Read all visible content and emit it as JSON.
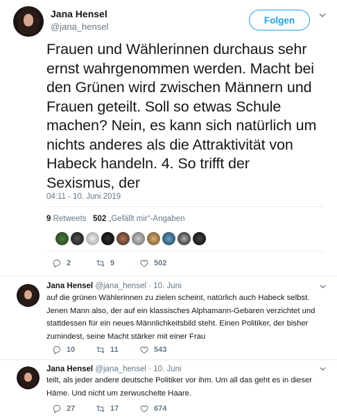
{
  "main_tweet": {
    "author_name": "Jana Hensel",
    "author_handle": "@jana_hensel",
    "follow_label": "Folgen",
    "text": "Frauen und Wählerinnen durchaus sehr ernst wahrgenommen werden. Macht bei den Grünen wird zwischen Männern und Frauen geteilt. Soll so etwas Schule machen? Nein, es kann sich natürlich um nichts anderes als die Attraktivität von Habeck handeln. 4. So trifft der Sexismus, der",
    "timestamp": "04:11 - 10. Juni 2019",
    "retweets_count": "9",
    "retweets_label": "Retweets",
    "likes_count": "502",
    "likes_label": "„Gefällt mir“-Angaben",
    "actions": {
      "replies": "2",
      "retweets": "9",
      "likes": "502"
    }
  },
  "replies": [
    {
      "author_name": "Jana Hensel",
      "author_handle": "@jana_hensel",
      "date": "· 10. Juni",
      "text": "auf die grünen Wählerinnen zu zielen scheint, natürlich auch Habeck selbst. Jenen Mann also, der auf ein klassisches  Alphamann-Gebaren verzichtet und stattdessen für ein neues Männlichkeitsbild steht. Einen Politiker, der bisher zumindest, seine Macht stärker mit einer Frau",
      "actions": {
        "replies": "10",
        "retweets": "11",
        "likes": "543"
      }
    },
    {
      "author_name": "Jana Hensel",
      "author_handle": "@jana_hensel",
      "date": "· 10. Juni",
      "text": "teilt, als jeder andere deutsche Politiker vor ihm. Um all das geht es in dieser Häme. Und nicht um zerwuschelte Haare.",
      "actions": {
        "replies": "27",
        "retweets": "17",
        "likes": "674"
      }
    }
  ],
  "colors": {
    "accent": "#1da1f2",
    "muted": "#657786",
    "text": "#14171a",
    "divider": "#e6ecf0"
  },
  "icons": [
    "reply-icon",
    "retweet-icon",
    "like-icon",
    "caret-down-icon"
  ]
}
